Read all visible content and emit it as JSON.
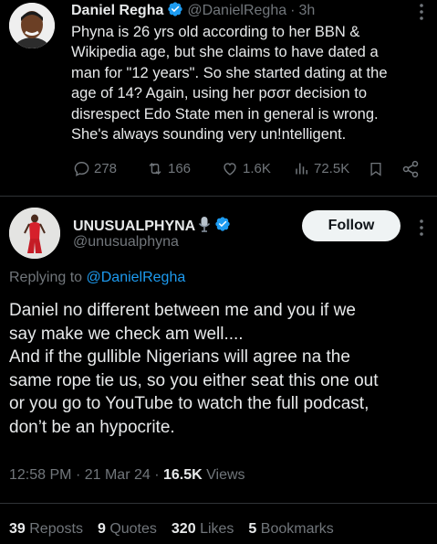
{
  "parent_tweet": {
    "display_name": "Daniel Regha",
    "handle": "@DanielRegha",
    "time": "3h",
    "separator": "·",
    "text_lines": [
      "Phyna is 26 yrs old according to her BBN &",
      "Wikipedia age, but she claims to have dated a",
      "man for \"12 years\". So she started dating at the",
      "age of 14? Again, using her pσσr decision to",
      "disrespect Edo State men in general is wrong.",
      "She's always  sounding very un!ntelligent."
    ],
    "actions": {
      "replies": "278",
      "reposts": "166",
      "likes": "1.6K",
      "views": "72.5K"
    }
  },
  "main_tweet": {
    "display_name": "UNUSUALPHYNA",
    "handle": "@unusualphyna",
    "follow_label": "Follow",
    "replying_to_prefix": "Replying to",
    "replying_to_handle": "@DanielRegha",
    "text_lines": [
      "Daniel no different between me and you if we",
      "say make we check am well....",
      "And if the gullible Nigerians will agree na the",
      "same rope tie us, so you either seat this one out",
      "or you go to YouTube to watch the full podcast,",
      "don’t be an hypocrite."
    ],
    "meta": {
      "time": "12:58 PM",
      "sep1": "·",
      "date": "21 Mar 24",
      "sep2": "·",
      "views_count": "16.5K",
      "views_label": "Views"
    },
    "stats": [
      {
        "count": "39",
        "label": "Reposts"
      },
      {
        "count": "9",
        "label": "Quotes"
      },
      {
        "count": "320",
        "label": "Likes"
      },
      {
        "count": "5",
        "label": "Bookmarks"
      }
    ]
  },
  "colors": {
    "background": "#000000",
    "text": "#e7e9ea",
    "muted": "#71767b",
    "link": "#1d9bf0",
    "verified": "#1d9bf0"
  }
}
